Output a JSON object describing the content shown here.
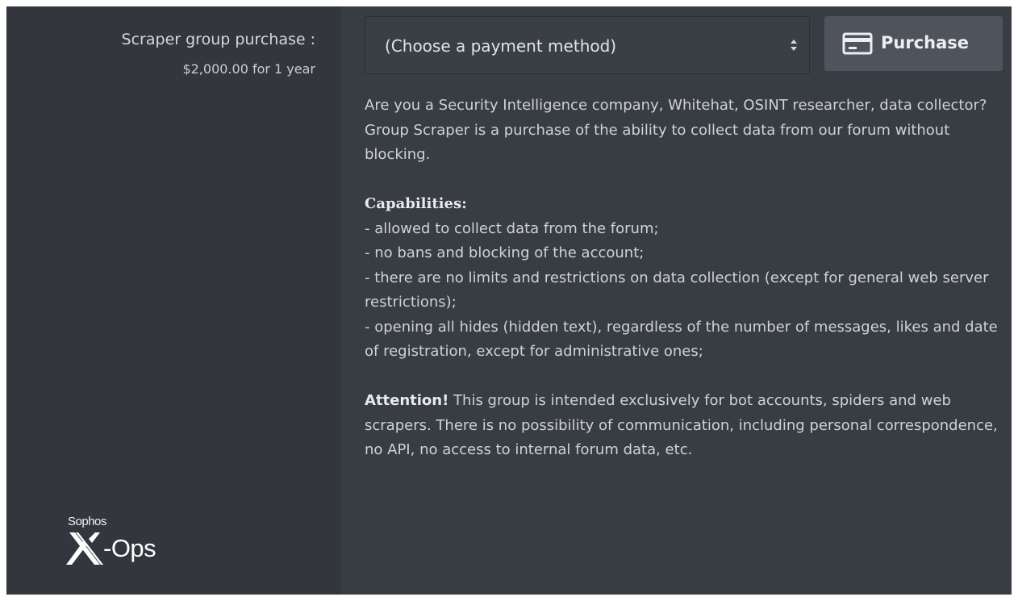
{
  "purchase_row": {
    "title": "Scraper group purchase :",
    "price": "$2,000.00 for 1 year"
  },
  "payment": {
    "selected": "(Choose a payment method)",
    "arrow_icon": "updown-arrows-icon"
  },
  "purchase_button": {
    "label": "Purchase",
    "icon": "credit-card-icon"
  },
  "description": {
    "intro": "Are you a Security Intelligence company, Whitehat, OSINT researcher, data collector? Group Scraper is a purchase of the ability to collect data from our forum without blocking.",
    "capabilities_heading": "Capabilities:",
    "capabilities": [
      "- allowed to collect data from the forum;",
      "- no bans and blocking of the account;",
      "- there are no limits and restrictions on data collection (except for general web server restrictions);",
      "- opening all hides (hidden text), regardless of the number of messages, likes and date of registration, except for administrative ones;"
    ],
    "attention_label": "Attention!",
    "attention_text": " This group is intended exclusively for bot accounts, spiders and web scrapers. There is no possibility of communication, including personal correspondence, no API, no access to internal forum data, etc."
  },
  "watermark": {
    "brand": "Sophos",
    "product": "-Ops"
  },
  "colors": {
    "panel_bg": "#383c43",
    "left_bg": "#33363c",
    "button_bg": "#4e535c",
    "text": "#cfd2d6"
  }
}
